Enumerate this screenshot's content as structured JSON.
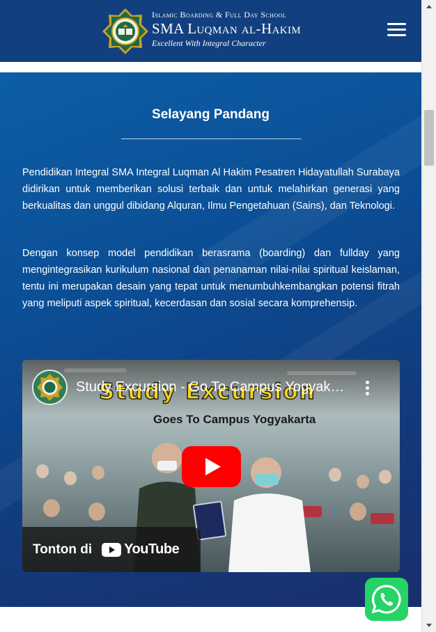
{
  "header": {
    "school_type": "Islamic Boarding & Full Day School",
    "school_name": "SMA Luqman al-Hakim",
    "tagline": "Excellent With Integral Character",
    "menu_icon": "hamburger-menu-icon",
    "background_color": "#123f7f"
  },
  "section": {
    "title": "Selayang Pandang",
    "paragraphs": [
      "Pendidikan Integral SMA Integral Luqman Al Hakim Pesatren Hidayatullah Surabaya didirikan untuk memberikan solusi terbaik dan untuk melahirkan generasi yang berkualitas dan unggul dibidang Alquran, Ilmu Pengetahuan (Sains), dan Teknologi.",
      "Dengan konsep model pendidikan berasrama (boarding) dan fullday yang mengintegrasikan kurikulum nasional dan penanaman nilai-nilai spiritual keislaman, tentu ini merupakan desain yang tepat untuk menumbuhkembangkan potensi fitrah yang meliputi aspek spiritual, kecerdasan dan sosial secara komprehensip."
    ]
  },
  "video": {
    "title": "Study Excursion - Go To Campus Yogyakarta",
    "thumbnail_banner": "Study Excursion",
    "thumbnail_subtitle": "Goes To Campus Yogyakarta",
    "watch_on_label": "Tonton di",
    "platform_label": "YouTube",
    "play_icon": "play-icon",
    "more_icon": "kebab-menu-icon"
  },
  "floating": {
    "whatsapp_icon": "whatsapp-icon",
    "whatsapp_color": "#25d366"
  }
}
